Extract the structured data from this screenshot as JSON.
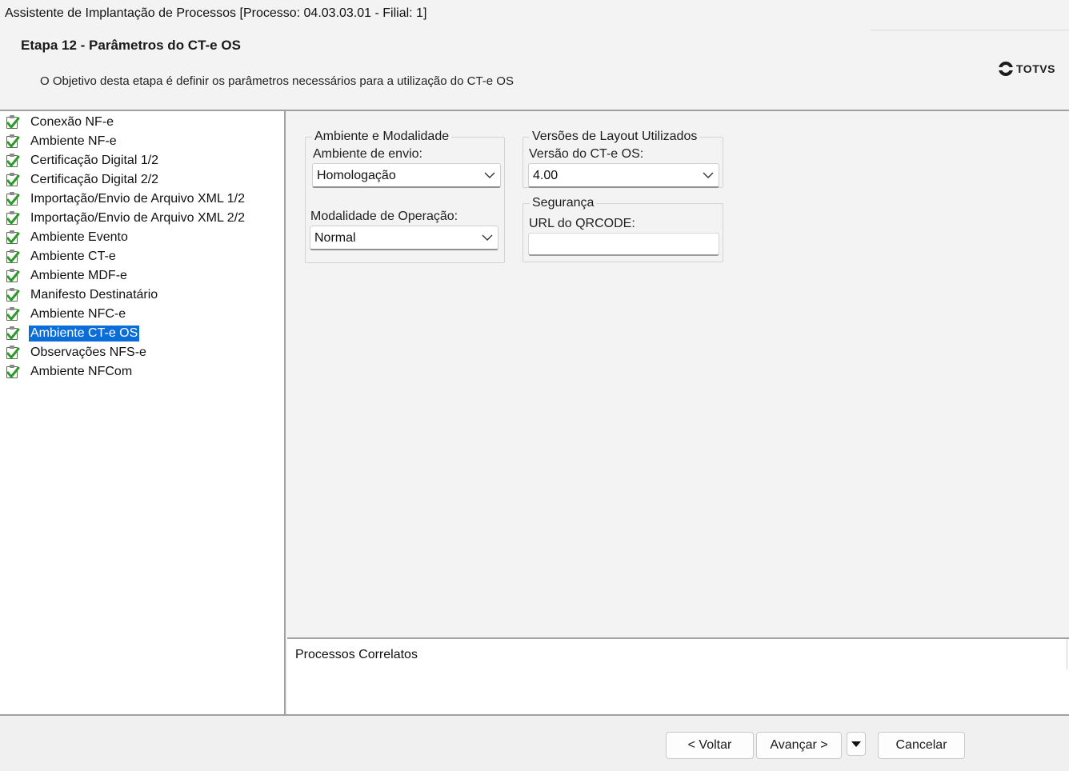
{
  "window": {
    "title": "Assistente de Implantação de Processos [Processo: 04.03.03.01 - Filial: 1]"
  },
  "header": {
    "step_title": "Etapa 12 - Parâmetros do CT-e OS",
    "description": "O Objetivo desta etapa é definir os parâmetros necessários para a utilização do CT-e OS",
    "logo_text": "TOTVS"
  },
  "tree": {
    "items": [
      {
        "label": "Conexão NF-e",
        "icon": "checked-document-icon"
      },
      {
        "label": "Ambiente NF-e",
        "icon": "checked-document-icon"
      },
      {
        "label": "Certificação Digital 1/2",
        "icon": "checked-document-icon"
      },
      {
        "label": "Certificação Digital 2/2",
        "icon": "checked-document-icon"
      },
      {
        "label": "Importação/Envio de Arquivo XML 1/2",
        "icon": "checked-document-icon"
      },
      {
        "label": "Importação/Envio de Arquivo XML 2/2",
        "icon": "checked-document-icon"
      },
      {
        "label": "Ambiente Evento",
        "icon": "checked-document-icon"
      },
      {
        "label": "Ambiente CT-e",
        "icon": "checked-document-icon"
      },
      {
        "label": "Ambiente MDF-e",
        "icon": "checked-document-icon"
      },
      {
        "label": "Manifesto Destinatário",
        "icon": "checked-document-icon"
      },
      {
        "label": "Ambiente NFC-e",
        "icon": "checked-document-icon"
      },
      {
        "label": "Ambiente CT-e OS",
        "icon": "checked-document-icon",
        "selected": true
      },
      {
        "label": "Observações NFS-e",
        "icon": "checked-document-icon"
      },
      {
        "label": "Ambiente NFCom",
        "icon": "checked-document-icon"
      }
    ]
  },
  "form": {
    "ambiente_group": {
      "legend": "Ambiente e Modalidade",
      "envio_label": "Ambiente de envio:",
      "envio_value": "Homologação",
      "modalidade_label": "Modalidade de Operação:",
      "modalidade_value": "Normal"
    },
    "layout_group": {
      "legend": "Versões de Layout Utilizados",
      "versao_label": "Versão do CT-e OS:",
      "versao_value": "4.00"
    },
    "seguranca_group": {
      "legend": "Segurança",
      "url_label": "URL do QRCODE:",
      "url_value": ""
    }
  },
  "related": {
    "label": "Processos Correlatos"
  },
  "footer": {
    "back_label": "< Voltar",
    "next_label": "Avançar >",
    "cancel_label": "Cancelar"
  },
  "colors": {
    "selection": "#0a6dd8",
    "check_green": "#2e9a2e"
  }
}
